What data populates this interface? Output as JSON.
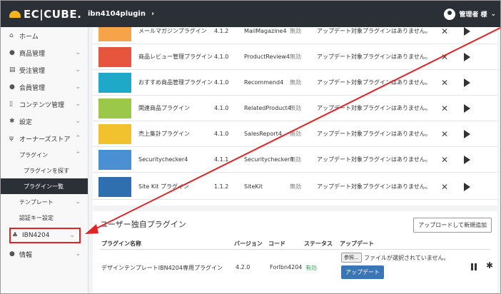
{
  "header": {
    "logo": "EC|CUBE.",
    "shop": "ibn4104plugin",
    "shop_chevron": "›",
    "user": "管理者 様",
    "user_chevron": "⌄"
  },
  "sidebar": {
    "home": "ホーム",
    "products": "商品管理",
    "orders": "受注管理",
    "members": "会員管理",
    "contents": "コンテンツ管理",
    "settings": "設定",
    "owners": "オーナーズストア",
    "plugins": "プラグイン",
    "find_plugin": "プラグインを探す",
    "plugin_list": "プラグイン一覧",
    "template": "テンプレート",
    "auth_key": "認証キー設定",
    "ibn": "IBN4204",
    "info": "情報"
  },
  "plugins": [
    {
      "name": "メールマガジンプラグイン",
      "ver": "4.1.2",
      "code": "MailMagazine4",
      "status": "無効",
      "msg": "アップデート対象プラグインはありません。",
      "thumb": "#f6a44a"
    },
    {
      "name": "商品レビュー管理プラグイン",
      "ver": "4.1.0",
      "code": "ProductReview4",
      "status": "無効",
      "msg": "アップデート対象プラグインはありません。",
      "thumb": "#e8553f"
    },
    {
      "name": "おすすめ商品管理プラグイン",
      "ver": "4.1.0",
      "code": "Recommend4",
      "status": "無効",
      "msg": "アップデート対象プラグインはありません。",
      "thumb": "#1fa9c9"
    },
    {
      "name": "関連商品プラグイン",
      "ver": "4.1.0",
      "code": "RelatedProduct4",
      "status": "無効",
      "msg": "アップデート対象プラグインはありません。",
      "thumb": "#9cc84a"
    },
    {
      "name": "売上集計プラグイン",
      "ver": "4.1.0",
      "code": "SalesReport4",
      "status": "無効",
      "msg": "アップデート対象プラグインはありません。",
      "thumb": "#f2c12e"
    },
    {
      "name": "Securitychecker4",
      "ver": "4.1.1",
      "code": "Securitychecker4",
      "status": "無効",
      "msg": "アップデート対象プラグインはありません。",
      "thumb": "#4a8fd1"
    },
    {
      "name": "Site Kit プラグイン",
      "ver": "1.1.2",
      "code": "SiteKit",
      "status": "無効",
      "msg": "アップデート対象プラグインはありません。",
      "thumb": "#2f6fb0"
    }
  ],
  "user_plugins": {
    "title": "ユーザー独自プラグイン",
    "upload_btn": "アップロードして新規追加",
    "th_name": "プラグイン名称",
    "th_ver": "バージョン",
    "th_code": "コード",
    "th_status": "ステータス",
    "th_update": "アップデート",
    "row_name": "デザインテンプレートIBN4204専用プラグイン",
    "row_ver": "4.2.0",
    "row_code": "ForIbn4204",
    "row_status": "有効",
    "browse": "参照...",
    "no_file": "ファイルが選択されていません。",
    "update_btn": "アップデート"
  },
  "colors": {
    "header": "#2b2f36",
    "accent": "#3976b8",
    "highlight": "#e02424",
    "enabled": "#3aa655"
  }
}
